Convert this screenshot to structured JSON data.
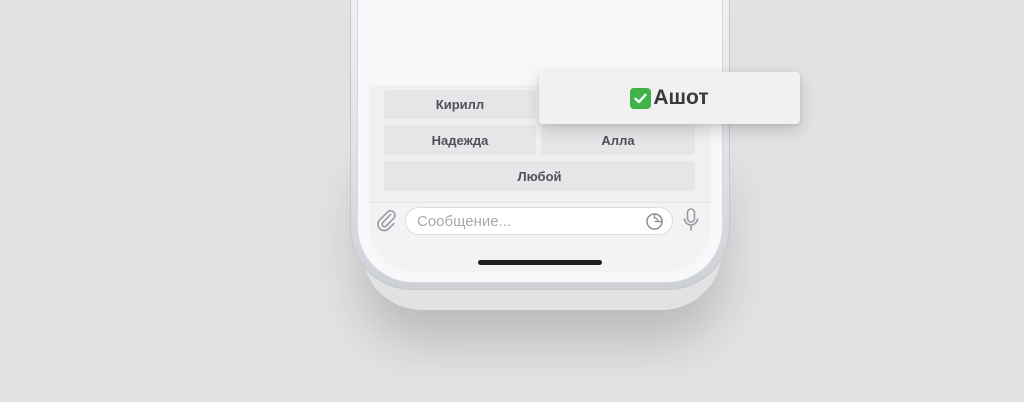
{
  "reply_keyboard": {
    "buttons": [
      {
        "label": "Кирилл"
      },
      {
        "label": "Надежда"
      },
      {
        "label": "Алла"
      },
      {
        "label": "Любой"
      }
    ],
    "selected": {
      "label": "Ашот",
      "icon": "check-mark-button-icon"
    }
  },
  "input_bar": {
    "placeholder": "Сообщение...",
    "attach_icon": "paperclip-icon",
    "sticker_icon": "sticker-icon",
    "mic_icon": "microphone-icon"
  },
  "colors": {
    "background": "#e2e2e2",
    "key_bg": "#e6e6e8",
    "key_text": "#505058",
    "check_green": "#3fb24a"
  }
}
